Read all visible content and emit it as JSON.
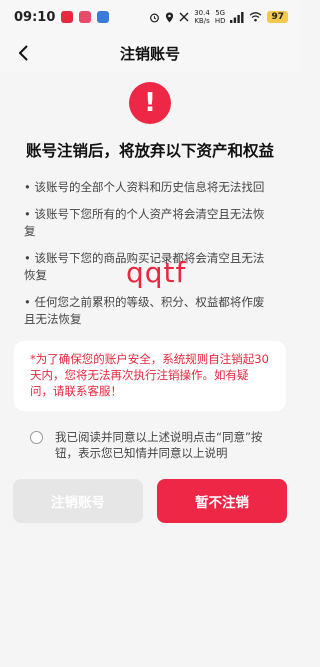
{
  "status_bar": {
    "time": "09:10",
    "net_speed": "30.4\nKB/s",
    "net_type": "5G\nHD",
    "battery": "97",
    "app_icon_colors": [
      "#e8283f",
      "#e84a6a",
      "#3a7bd5"
    ]
  },
  "nav": {
    "title": "注销账号"
  },
  "headline": "账号注销后，将放弃以下资产和权益",
  "rules": [
    "• 该账号的全部个人资料和历史信息将无法找回",
    "• 该账号下您所有的个人资产将会清空且无法恢复",
    "• 该账号下您的商品购买记录都将会清空且无法恢复",
    "• 任何您之前累积的等级、积分、权益都将作废且无法恢复"
  ],
  "notice": "*为了确保您的账户安全，系统规则自注销起30天内，您将无法再次执行注销操作。如有疑问，请联系客服！",
  "watermark": "qqtf",
  "agreement": "我已阅读并同意以上述说明点击“同意”按钮，表示您已知情并同意以上说明",
  "buttons": {
    "cancel_account": "注销账号",
    "keep": "暂不注销"
  },
  "colors": {
    "accent": "#ee2746",
    "disabled_button": "#e6e6e6",
    "background": "#f5f5f5"
  }
}
